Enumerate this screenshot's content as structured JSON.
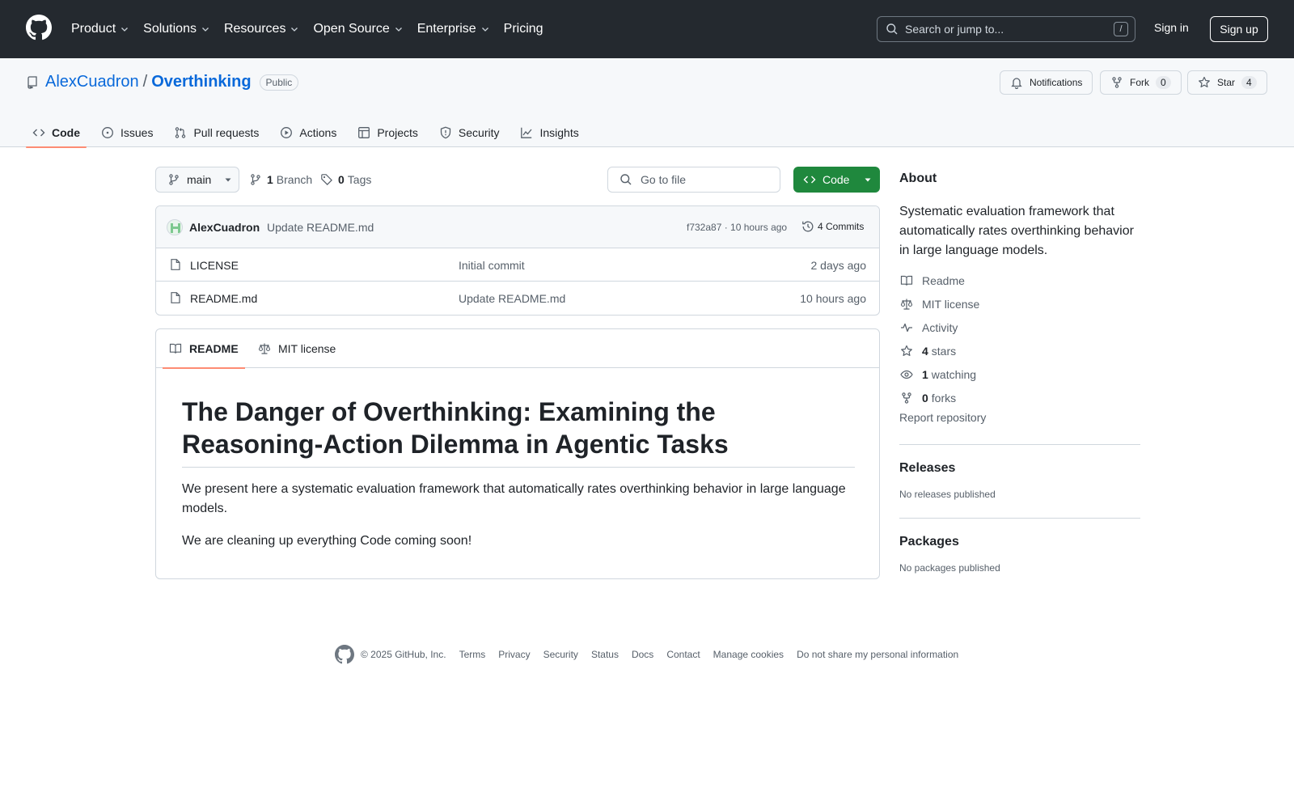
{
  "topnav": {
    "items": [
      {
        "label": "Product",
        "has_menu": true
      },
      {
        "label": "Solutions",
        "has_menu": true
      },
      {
        "label": "Resources",
        "has_menu": true
      },
      {
        "label": "Open Source",
        "has_menu": true
      },
      {
        "label": "Enterprise",
        "has_menu": true
      },
      {
        "label": "Pricing",
        "has_menu": false
      }
    ],
    "search_placeholder": "Search or jump to...",
    "search_shortcut": "/",
    "signin": "Sign in",
    "signup": "Sign up"
  },
  "repo": {
    "owner": "AlexCuadron",
    "separator": "/",
    "name": "Overthinking",
    "visibility": "Public",
    "notifications": "Notifications",
    "fork_label": "Fork",
    "fork_count": "0",
    "star_label": "Star",
    "star_count": "4"
  },
  "tabs": [
    {
      "label": "Code",
      "icon": "code-icon",
      "active": true
    },
    {
      "label": "Issues",
      "icon": "issue-icon",
      "active": false
    },
    {
      "label": "Pull requests",
      "icon": "pull-request-icon",
      "active": false
    },
    {
      "label": "Actions",
      "icon": "play-icon",
      "active": false
    },
    {
      "label": "Projects",
      "icon": "table-icon",
      "active": false
    },
    {
      "label": "Security",
      "icon": "shield-icon",
      "active": false
    },
    {
      "label": "Insights",
      "icon": "graph-icon",
      "active": false
    }
  ],
  "filenav": {
    "branch": "main",
    "branch_count": "1",
    "branch_label": "Branch",
    "tag_count": "0",
    "tag_label": "Tags",
    "goto_placeholder": "Go to file",
    "code_button": "Code"
  },
  "commit": {
    "author": "AlexCuadron",
    "message": "Update README.md",
    "meta": "f732a87 · 10 hours ago",
    "commits": "4 Commits"
  },
  "files": [
    {
      "name": "LICENSE",
      "message": "Initial commit",
      "date": "2 days ago"
    },
    {
      "name": "README.md",
      "message": "Update README.md",
      "date": "10 hours ago"
    }
  ],
  "readme": {
    "tab_readme": "README",
    "tab_license": "MIT license",
    "title": "The Danger of Overthinking: Examining the Reasoning-Action Dilemma in Agentic Tasks",
    "p1": "We present here a systematic evaluation framework that automatically rates overthinking behavior in large language models.",
    "p2": "We are cleaning up everything Code coming soon!"
  },
  "about": {
    "heading": "About",
    "description": "Systematic evaluation framework that automatically rates overthinking behavior in large language models.",
    "readme": "Readme",
    "license": "MIT license",
    "activity": "Activity",
    "stars_count": "4",
    "stars_label": "stars",
    "watching_count": "1",
    "watching_label": "watching",
    "forks_count": "0",
    "forks_label": "forks",
    "report": "Report repository"
  },
  "releases": {
    "heading": "Releases",
    "empty": "No releases published"
  },
  "packages": {
    "heading": "Packages",
    "empty": "No packages published"
  },
  "footer": {
    "copyright": "© 2025 GitHub, Inc.",
    "links": [
      "Terms",
      "Privacy",
      "Security",
      "Status",
      "Docs",
      "Contact",
      "Manage cookies",
      "Do not share my personal information"
    ]
  },
  "colors": {
    "header_bg": "#24292f",
    "link": "#0969da",
    "primary_button": "#1f883d",
    "active_tab_underline": "#fd8c73"
  }
}
